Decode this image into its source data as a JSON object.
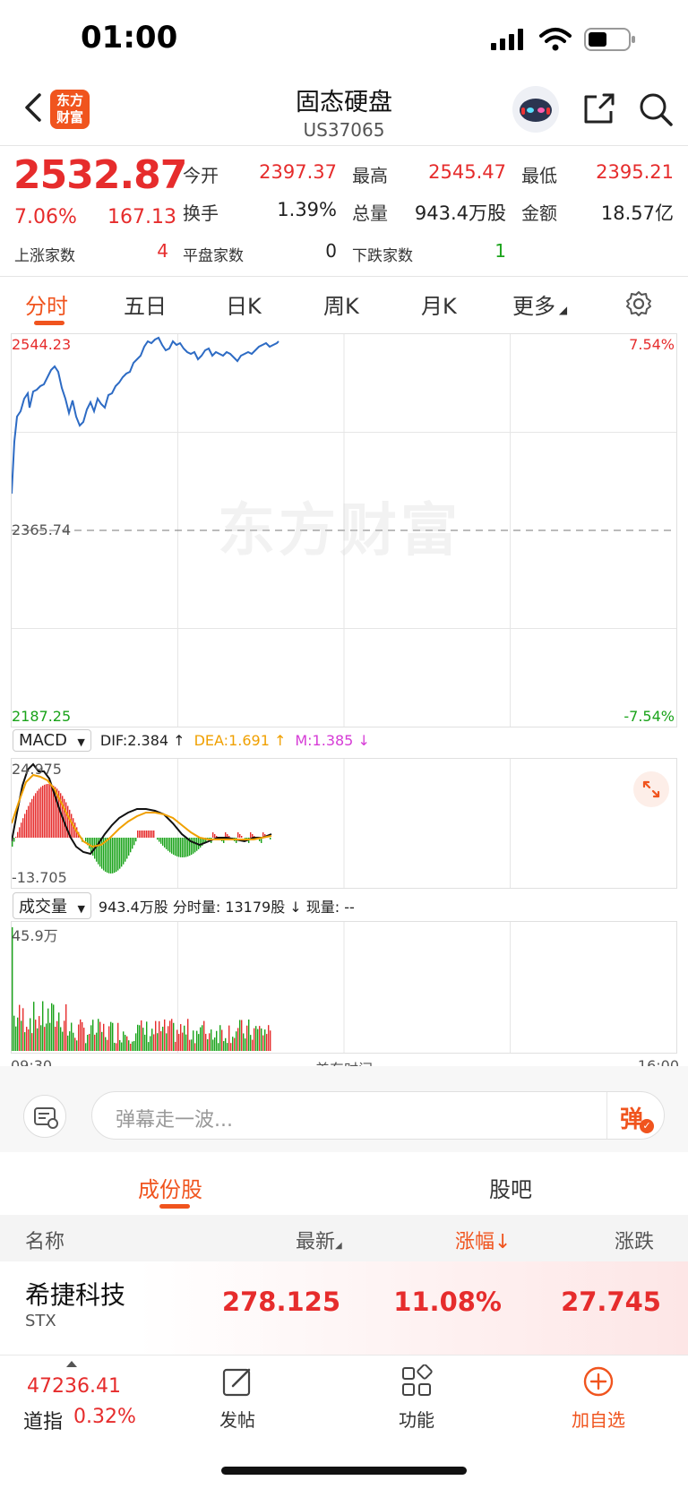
{
  "status_bar": {
    "time": "01:00"
  },
  "nav": {
    "brand": "东方财富",
    "title": "固态硬盘",
    "code": "US37065"
  },
  "quote": {
    "price": "2532.87",
    "change_pct": "7.06%",
    "change": "167.13",
    "open_label": "今开",
    "open": "2397.37",
    "high_label": "最高",
    "high": "2545.47",
    "low_label": "最低",
    "low": "2395.21",
    "turnover_label": "换手",
    "turnover": "1.39%",
    "volume_label": "总量",
    "volume": "943.4万股",
    "amount_label": "金额",
    "amount": "18.57亿",
    "up_label": "上涨家数",
    "up": "4",
    "flat_label": "平盘家数",
    "flat": "0",
    "down_label": "下跌家数",
    "down": "1"
  },
  "tabs": [
    "分时",
    "五日",
    "日K",
    "周K",
    "月K",
    "更多"
  ],
  "chart": {
    "high_price": "2544.23",
    "mid_price": "2365.74",
    "low_price": "2187.25",
    "high_pct": "7.54%",
    "low_pct": "-7.54%",
    "watermark": "东方财富"
  },
  "macd": {
    "selector": "MACD",
    "dif": "DIF:2.384 ↑",
    "dea": "DEA:1.691 ↑",
    "m": "M:1.385 ↓",
    "max": "24.975",
    "min": "-13.705"
  },
  "volume_panel": {
    "selector": "成交量",
    "info": "943.4万股  分时量: 13179股 ↓  现量: --",
    "max": "45.9万"
  },
  "time_axis": {
    "start": "09:30",
    "mid": "美东时间",
    "end": "16:00"
  },
  "comment": {
    "placeholder": "弹幕走一波...",
    "danmu_button": "弹"
  },
  "lower_tabs": [
    "成份股",
    "股吧"
  ],
  "table": {
    "headers": [
      "名称",
      "最新",
      "涨幅",
      "涨跌"
    ],
    "rows": [
      {
        "name": "希捷科技",
        "code": "STX",
        "latest": "278.125",
        "pct": "11.08%",
        "change": "27.745"
      }
    ]
  },
  "bottom_bar": {
    "index_value": "47236.41",
    "index_name": "道指",
    "index_pct": "0.32%",
    "post": "发帖",
    "functions": "功能",
    "add_watch": "加自选"
  },
  "colors": {
    "up": "#e62c2c",
    "down": "#1aa31a",
    "accent": "#f0541e",
    "price_line": "#2d6bc4",
    "dea": "#f0a000",
    "m": "#d63cd6"
  }
}
